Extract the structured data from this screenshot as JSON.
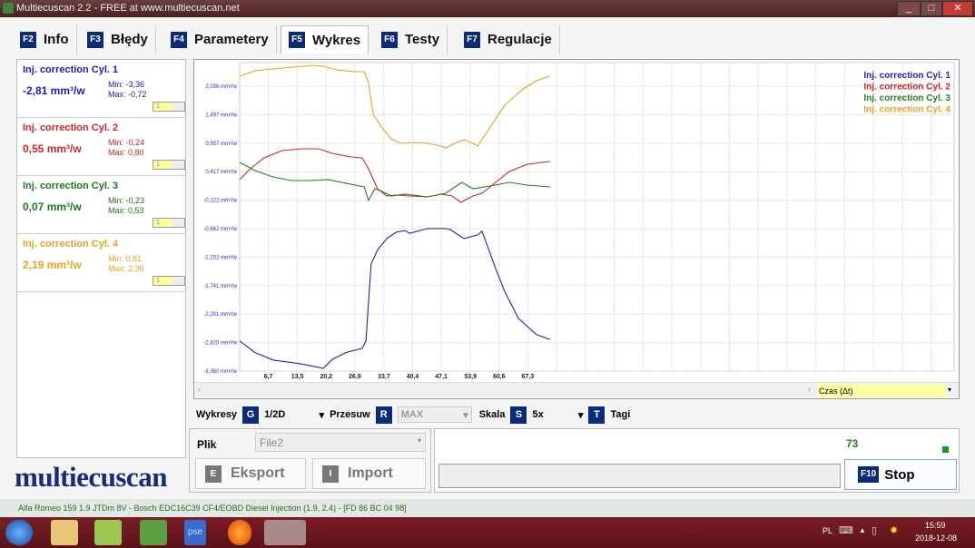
{
  "window": {
    "title": "Multiecuscan 2.2 - FREE at www.multiecuscan.net",
    "min": "_",
    "max": "□",
    "close": "✕"
  },
  "tabs": [
    {
      "key": "F2",
      "label": "Info"
    },
    {
      "key": "F3",
      "label": "Błędy"
    },
    {
      "key": "F4",
      "label": "Parametery"
    },
    {
      "key": "F5",
      "label": "Wykres",
      "active": true
    },
    {
      "key": "F6",
      "label": "Testy"
    },
    {
      "key": "F7",
      "label": "Regulacje"
    }
  ],
  "cylinders": [
    {
      "name": "Inj. correction Cyl. 1",
      "value": "-2,81 mm³/w",
      "min": "Min: -3,36",
      "max": "Max: -0,72",
      "color": "#1a1acc",
      "sel": "1"
    },
    {
      "name": "Inj. correction Cyl. 2",
      "value": "0,55 mm³/w",
      "min": "Min: -0,24",
      "max": "Max: 0,80",
      "color": "#e02020",
      "sel": "1"
    },
    {
      "name": "Inj. correction Cyl. 3",
      "value": "0,07 mm³/w",
      "min": "Min: -0,23",
      "max": "Max: 0,53",
      "color": "#1a7a1a",
      "sel": "1"
    },
    {
      "name": "Inj. correction Cyl. 4",
      "value": "2,19 mm³/w",
      "min": "Min: 0,81",
      "max": "Max: 2,36",
      "color": "#f0a020",
      "sel": "1"
    }
  ],
  "chart_data": {
    "type": "line",
    "ylim": [
      -3.36,
      2.483
    ],
    "yticks": [
      "2,036 mm³/w",
      "1,497 mm³/w",
      "0,957 mm³/w",
      "0,417 mm³/w",
      "-0,122 mm³/w",
      "-0,662 mm³/w",
      "-1,202 mm³/w",
      "-1,741 mm³/w",
      "-2,281 mm³/w",
      "-2,820 mm³/w",
      "-3,360 mm³/w"
    ],
    "ytick_values": [
      2.036,
      1.497,
      0.957,
      0.417,
      -0.122,
      -0.662,
      -1.202,
      -1.741,
      -2.281,
      -2.82,
      -3.36
    ],
    "xticks": [
      "6,7",
      "13,5",
      "20,2",
      "26,9",
      "33,7",
      "40,4",
      "47,1",
      "53,9",
      "60,6",
      "67,3"
    ],
    "xtick_values": [
      6.7,
      13.5,
      20.2,
      26.9,
      33.7,
      40.4,
      47.1,
      53.9,
      60.6,
      67.3
    ],
    "xlim": [
      0,
      166.9
    ],
    "x_axis_selector": "Czas (Δt)",
    "legend_position": "top-right",
    "series": [
      {
        "name": "Inj. correction Cyl. 1",
        "color": "#2020d0",
        "x": [
          0,
          3.6,
          7.8,
          14.2,
          18.4,
          19.5,
          21.6,
          24.8,
          28.6,
          29.5,
          30.7,
          32.2,
          34.4,
          36.5,
          38.6,
          39.7,
          43.9,
          48.1,
          49.2,
          52.4,
          55.6,
          56.6,
          59.8,
          61.9,
          65.1,
          69.3,
          72.5
        ],
        "y": [
          -2.79,
          -3.01,
          -3.15,
          -3.22,
          -3.29,
          -3.31,
          -3.14,
          -3.01,
          -2.93,
          -2.79,
          -1.33,
          -1.07,
          -0.85,
          -0.73,
          -0.7,
          -0.75,
          -0.66,
          -0.66,
          -0.68,
          -0.85,
          -0.78,
          -0.71,
          -1.42,
          -1.85,
          -2.36,
          -2.67,
          -2.76
        ]
      },
      {
        "name": "Inj. correction Cyl. 2",
        "color": "#e02020",
        "x": [
          0,
          2.5,
          5.7,
          9.9,
          14.2,
          18.4,
          21.6,
          25.9,
          28.6,
          30.1,
          32.2,
          34.4,
          36.5,
          39.7,
          43.9,
          47.1,
          49.6,
          51.7,
          54.5,
          56.6,
          59.8,
          63,
          67.2,
          72.5
        ],
        "y": [
          0.267,
          0.473,
          0.679,
          0.816,
          0.851,
          0.851,
          0.765,
          0.696,
          0.679,
          0.473,
          0.095,
          -0.043,
          -0.026,
          -0.043,
          -0.06,
          -0.008,
          -0.043,
          -0.163,
          -0.043,
          0.009,
          0.215,
          0.421,
          0.559,
          0.61
        ]
      },
      {
        "name": "Inj. correction Cyl. 3",
        "color": "#208020",
        "x": [
          0,
          3.6,
          7.8,
          12.1,
          16.3,
          20.6,
          23.8,
          29.1,
          30.1,
          31.6,
          33.3,
          35.4,
          38.6,
          43.9,
          48.1,
          51.9,
          54.5,
          59.8,
          63,
          67.2,
          72.5
        ],
        "y": [
          0.593,
          0.438,
          0.318,
          0.249,
          0.249,
          0.267,
          0.215,
          0.129,
          -0.128,
          0.095,
          0.043,
          -0.043,
          -0.008,
          -0.06,
          0.009,
          0.215,
          0.095,
          0.163,
          0.215,
          0.163,
          0.129
        ]
      },
      {
        "name": "Inj. correction Cyl. 4",
        "color": "#f0a020",
        "x": [
          0,
          3.6,
          7.8,
          12.1,
          17.4,
          19.5,
          22.7,
          27,
          29.1,
          30.1,
          31.2,
          33.3,
          35.4,
          37.5,
          40.7,
          43.9,
          47.1,
          48.1,
          50.3,
          52.4,
          54.5,
          55.6,
          57.7,
          61.9,
          66.2,
          69.3,
          72.5
        ],
        "y": [
          2.225,
          2.328,
          2.362,
          2.397,
          2.431,
          2.414,
          2.345,
          2.311,
          2.311,
          2.105,
          1.503,
          1.246,
          1.04,
          0.954,
          0.971,
          0.954,
          0.902,
          0.868,
          0.954,
          1.023,
          0.954,
          0.902,
          1.16,
          1.675,
          1.984,
          2.139,
          2.225
        ]
      }
    ]
  },
  "controls": {
    "wykresy": "Wykresy",
    "g": "G",
    "wykresy_val": "1/2D",
    "przesuw": "Przesuw",
    "r": "R",
    "przesuw_val": "MAX",
    "skala": "Skala",
    "s": "S",
    "skala_val": "5x",
    "t": "T",
    "tagi": "Tagi"
  },
  "file": {
    "label": "Plik",
    "value": "File2",
    "export_key": "E",
    "export": "Eksport",
    "import_key": "I",
    "import": "Import"
  },
  "run": {
    "count": "73",
    "stop_key": "F10",
    "stop": "Stop"
  },
  "logo": "multiecuscan",
  "status": "Alfa Romeo 159 1.9 JTDm 8V - Bosch EDC16C39 CF4/EOBD Diesel Injection (1.9, 2.4) - [FD 86 BC 04 98]",
  "tray": {
    "lang": "PL",
    "time": "15:59",
    "date": "2018-12-08"
  }
}
